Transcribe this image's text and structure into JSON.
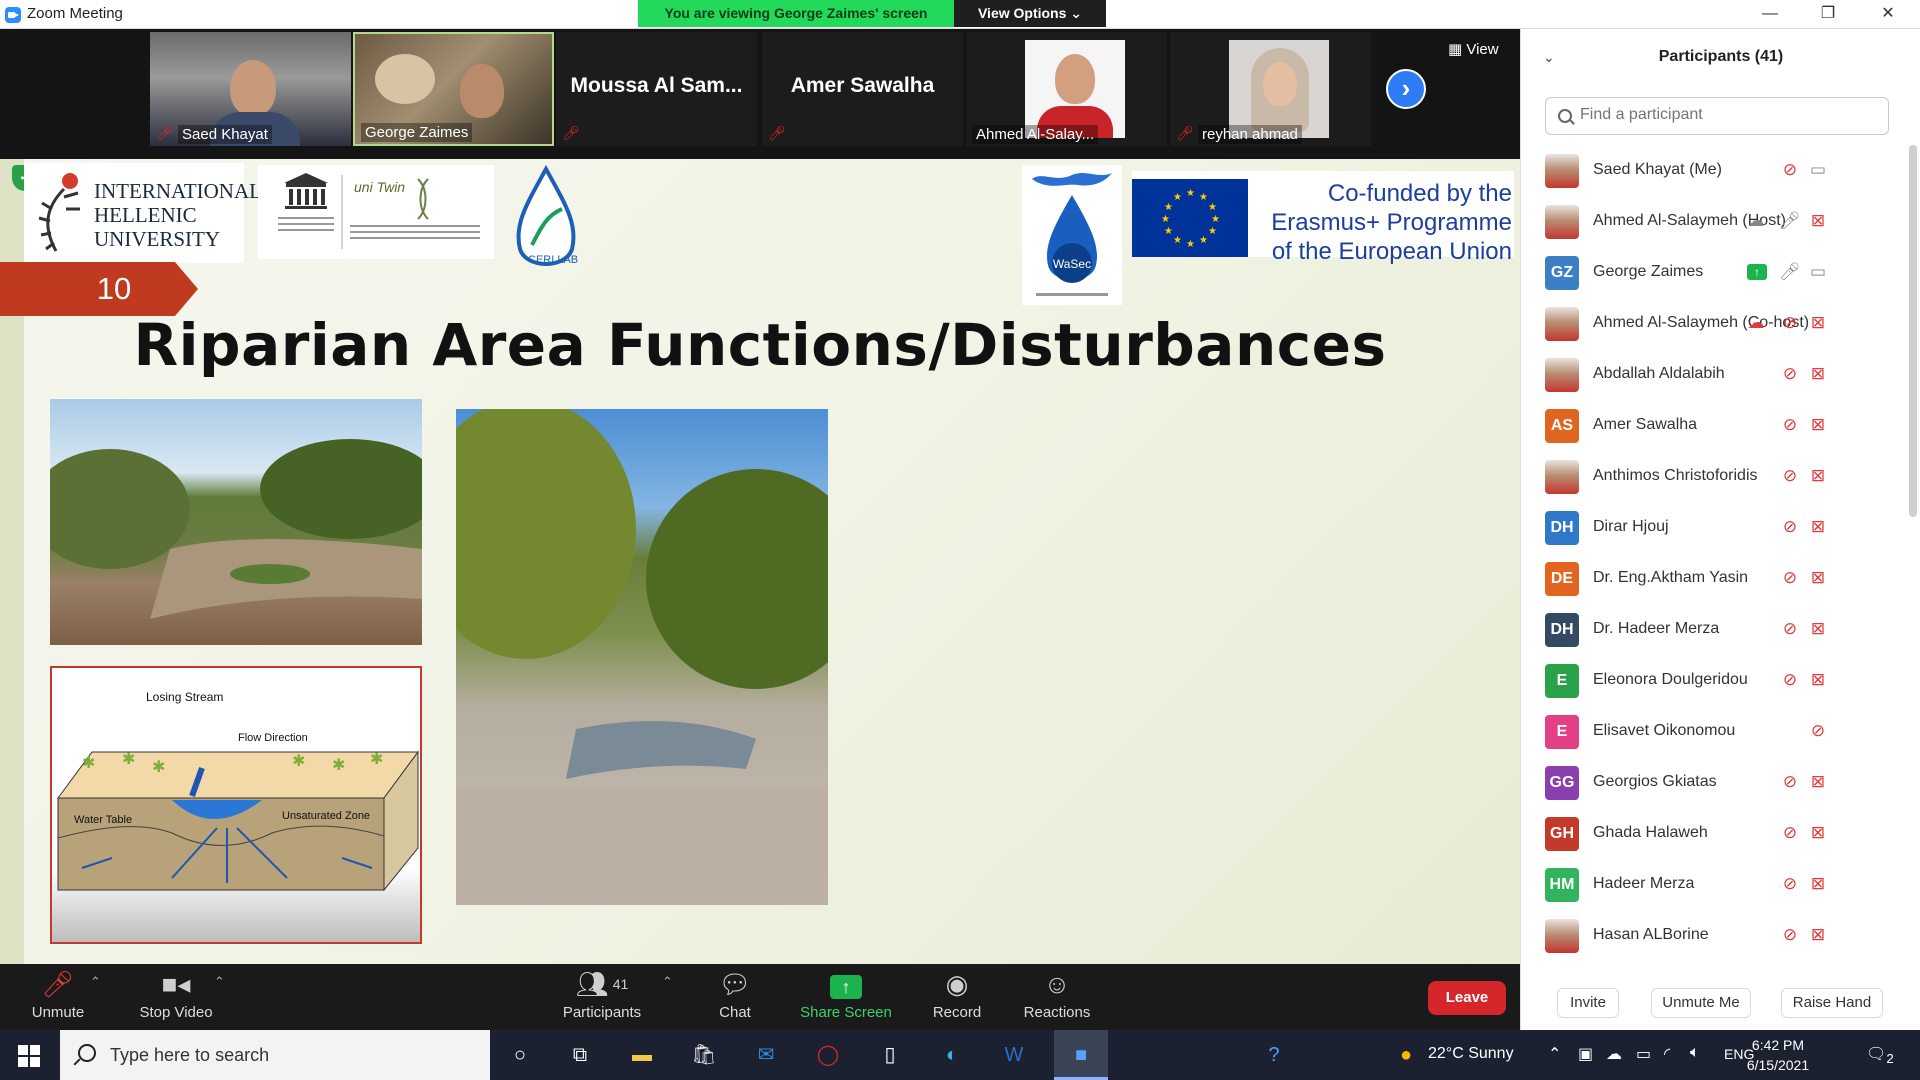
{
  "window": {
    "title": "Zoom Meeting",
    "viewing_banner": "You are viewing George Zaimes' screen",
    "view_options": "View Options ⌄"
  },
  "gallery": {
    "tiles": [
      {
        "name": "Saed Khayat",
        "type": "video",
        "muted": true
      },
      {
        "name": "George Zaimes",
        "type": "video",
        "muted": false
      },
      {
        "name": "Moussa Al Sam...",
        "type": "name",
        "muted": true
      },
      {
        "name": "Amer Sawalha",
        "type": "name",
        "muted": true
      },
      {
        "name": "Ahmed Al-Salay...",
        "type": "photo",
        "muted": false
      },
      {
        "name": "reyhan ahmad",
        "type": "photo",
        "muted": true
      }
    ],
    "view_label": "View"
  },
  "slide": {
    "number": "10",
    "title": "Riparian Area Functions/Disturbances",
    "ihu_lines": [
      "INTERNATIONAL",
      "HELLENIC",
      "UNIVERSITY"
    ],
    "unitwin_label": "uni Twin",
    "wasec_label": "WaSec",
    "erasmus_lines": [
      "Co-funded by the",
      "Erasmus+ Programme",
      "of the European Union"
    ],
    "diagram": {
      "title": "Losing Stream",
      "flow": "Flow Direction",
      "water_table": "Water Table",
      "unsaturated": "Unsaturated Zone"
    }
  },
  "panel": {
    "title": "Participants (41)",
    "search_placeholder": "Find a participant",
    "participants": [
      {
        "name": "Saed Khayat (Me)",
        "avatar": "photo",
        "color": "#ffffff",
        "mic": "muted",
        "cam": "on",
        "extra": ""
      },
      {
        "name": "Ahmed Al-Salaymeh (Host)",
        "avatar": "photo",
        "color": "#ffffff",
        "mic": "on",
        "cam": "off",
        "extra": "cloud"
      },
      {
        "name": "George Zaimes",
        "initials": "GZ",
        "color": "#3d7fc4",
        "mic": "on",
        "cam": "on",
        "extra": "share"
      },
      {
        "name": "Ahmed Al-Salaymeh (Co-host)",
        "avatar": "photo",
        "color": "#ffffff",
        "mic": "muted",
        "cam": "off",
        "extra": "cloud-red"
      },
      {
        "name": "Abdallah Aldalabih",
        "avatar": "photo",
        "color": "#ffffff",
        "mic": "muted",
        "cam": "off",
        "extra": ""
      },
      {
        "name": "Amer Sawalha",
        "initials": "AS",
        "color": "#e0661f",
        "mic": "muted",
        "cam": "off",
        "extra": ""
      },
      {
        "name": "Anthimos Christoforidis",
        "avatar": "photo",
        "color": "#ffffff",
        "mic": "muted",
        "cam": "off",
        "extra": ""
      },
      {
        "name": "Dirar Hjouj",
        "initials": "DH",
        "color": "#2f79c8",
        "mic": "muted",
        "cam": "off",
        "extra": ""
      },
      {
        "name": "Dr. Eng.Aktham Yasin",
        "initials": "DE",
        "color": "#e2641e",
        "mic": "muted",
        "cam": "off",
        "extra": ""
      },
      {
        "name": "Dr. Hadeer Merza",
        "initials": "DH",
        "color": "#344a63",
        "mic": "muted",
        "cam": "off",
        "extra": ""
      },
      {
        "name": "Eleonora Doulgeridou",
        "initials": "E",
        "color": "#2aa24a",
        "mic": "muted",
        "cam": "off",
        "extra": ""
      },
      {
        "name": "Elisavet Oikonomou",
        "initials": "E",
        "color": "#e23f86",
        "mic": "none",
        "cam": "muted-mic-only",
        "extra": ""
      },
      {
        "name": "Georgios Gkiatas",
        "initials": "GG",
        "color": "#8a3fb0",
        "mic": "muted",
        "cam": "off",
        "extra": ""
      },
      {
        "name": "Ghada Halaweh",
        "initials": "GH",
        "color": "#c43a2a",
        "mic": "muted",
        "cam": "off",
        "extra": ""
      },
      {
        "name": "Hadeer Merza",
        "initials": "HM",
        "color": "#31b45d",
        "mic": "muted",
        "cam": "off",
        "extra": ""
      },
      {
        "name": "Hasan ALBorine",
        "avatar": "photo",
        "color": "#ffffff",
        "mic": "muted",
        "cam": "off",
        "extra": ""
      }
    ],
    "footer": {
      "invite": "Invite",
      "unmute_me": "Unmute Me",
      "raise_hand": "Raise Hand"
    }
  },
  "controls": {
    "unmute": "Unmute",
    "stop_video": "Stop Video",
    "participants": "Participants",
    "participants_count": "41",
    "chat": "Chat",
    "share_screen": "Share Screen",
    "record": "Record",
    "reactions": "Reactions",
    "leave": "Leave"
  },
  "taskbar": {
    "search_placeholder": "Type here to search",
    "weather": "22°C  Sunny",
    "lang": "ENG",
    "time": "6:42 PM",
    "date": "6/15/2021",
    "notifications": "2"
  }
}
